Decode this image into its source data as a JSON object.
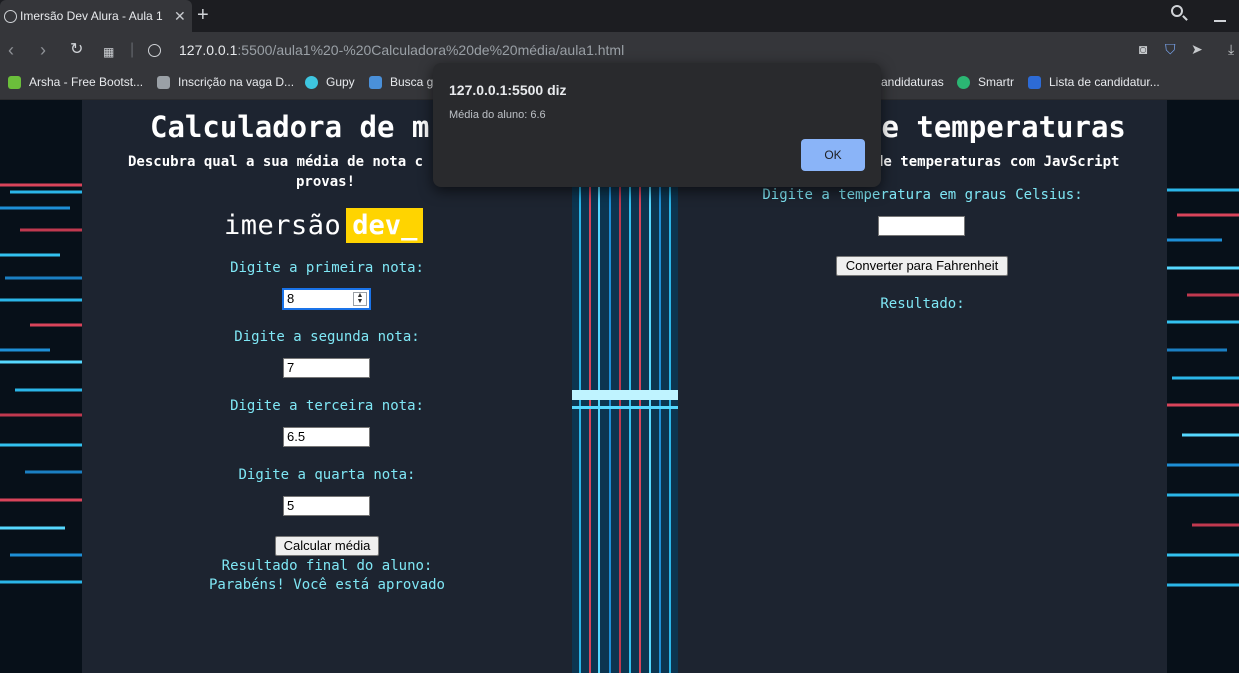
{
  "browser": {
    "tab_title": "Imersão Dev Alura - Aula 1",
    "tab_close": "✕",
    "new_tab": "+",
    "url_host": "127.0.0.1",
    "url_path": ":5500/aula1%20-%20Calculadora%20de%20média/aula1.html",
    "bookmarks": [
      {
        "label": "Arsha - Free Bootst...",
        "color": "#6bbf3b"
      },
      {
        "label": "Inscrição na vaga D...",
        "color": "#9aa0a6"
      },
      {
        "label": "Gupy",
        "color": "#3ec6e0"
      },
      {
        "label": "Busca g",
        "color": "#4a90d9"
      },
      {
        "label": "andidaturas",
        "color": "#f5a623"
      },
      {
        "label": "Smartr",
        "color": "#2bb673"
      },
      {
        "label": "Lista de candidatur...",
        "color": "#2d6bd6"
      }
    ]
  },
  "calculator": {
    "title": "Calculadora de m",
    "subtitle_line1": "Descubra qual a sua média de nota c",
    "subtitle_line2": "provas!",
    "logo_text": "imersão",
    "logo_highlight": "dev_",
    "label1": "Digite a primeira nota:",
    "value1": "8",
    "label2": "Digite a segunda nota:",
    "value2": "7",
    "label3": "Digite a terceira nota:",
    "value3": "6.5",
    "label4": "Digite a quarta nota:",
    "value4": "5",
    "button_label": "Calcular média",
    "result_label": "Resultado final do aluno:",
    "result_value": "Parabéns! Você está aprovado"
  },
  "converter": {
    "title": "de temperaturas",
    "subtitle": "de temperaturas com JavScript",
    "label": "Digite a temperatura em graus Celsius:",
    "value": "",
    "button_label": "Converter para Fahrenheit",
    "result_label": "Resultado:"
  },
  "dialog": {
    "title": "127.0.0.1:5500 diz",
    "message": "Média do aluno: 6.6",
    "ok_label": "OK"
  },
  "colors": {
    "panel_bg": "#1d2430",
    "label_color": "#7fe7f5",
    "logo_highlight_bg": "#ffd400",
    "dialog_button": "#8ab4f8"
  }
}
